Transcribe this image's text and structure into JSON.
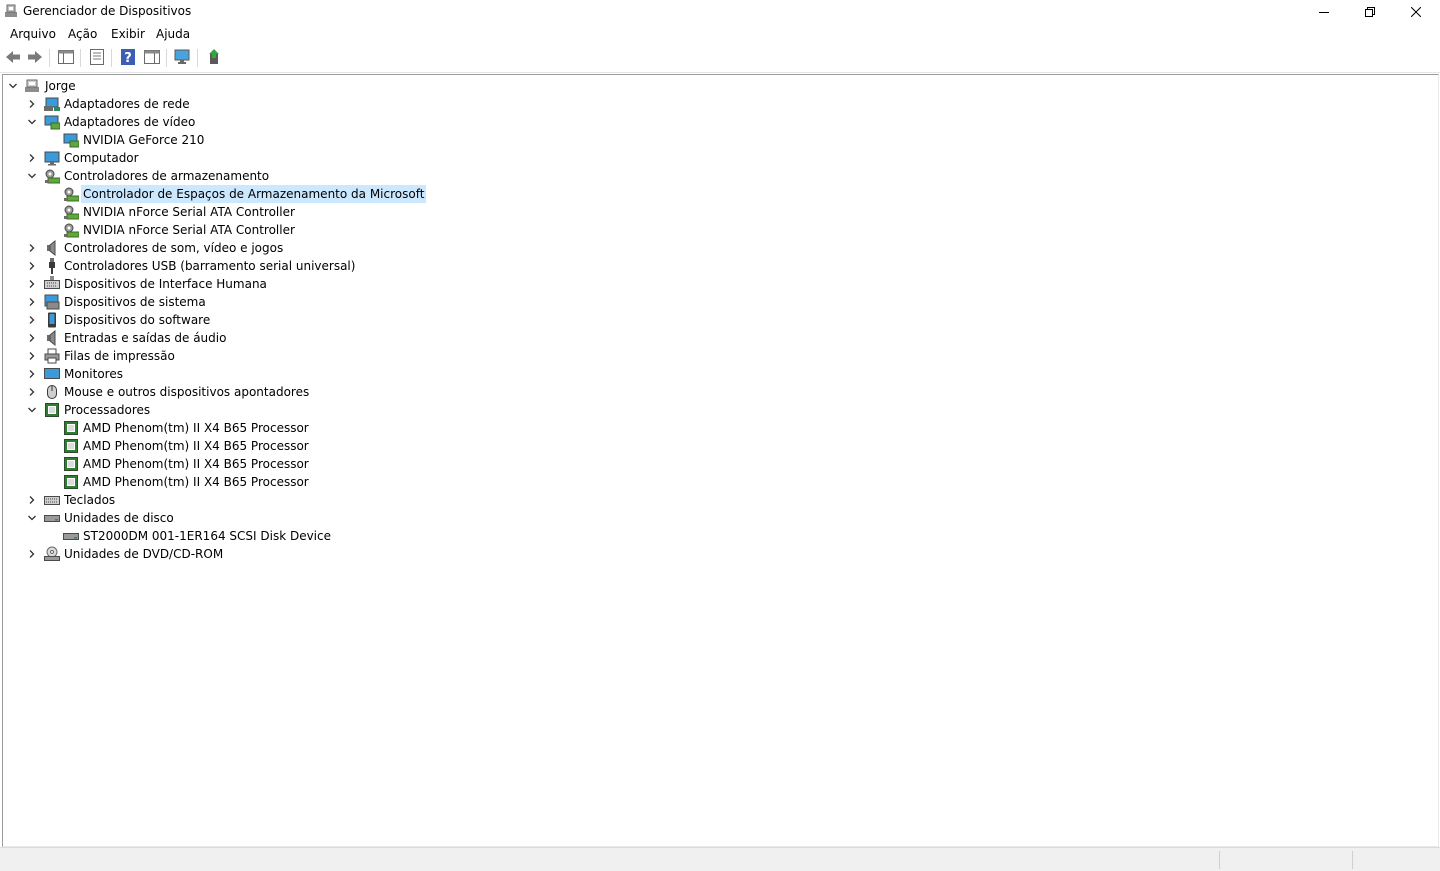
{
  "window": {
    "title": "Gerenciador de Dispositivos",
    "controls": {
      "minimize": "minimize-icon",
      "restore": "restore-icon",
      "close": "close-icon"
    }
  },
  "menu": {
    "items": [
      {
        "label": "Arquivo"
      },
      {
        "label": "Ação"
      },
      {
        "label": "Exibir"
      },
      {
        "label": "Ajuda"
      }
    ]
  },
  "toolbar": {
    "buttons": [
      {
        "icon": "back-arrow-icon"
      },
      {
        "icon": "forward-arrow-icon"
      },
      {
        "icon": "show-hide-console-tree-icon"
      },
      {
        "icon": "properties-icon"
      },
      {
        "icon": "help-icon"
      },
      {
        "icon": "action-pane-icon"
      },
      {
        "icon": "scan-hardware-icon"
      },
      {
        "icon": "add-legacy-hardware-icon"
      }
    ]
  },
  "tree": {
    "root": {
      "label": "Jorge",
      "expanded": true,
      "icon": "computer-root-icon"
    },
    "items": [
      {
        "label": "Adaptadores de rede",
        "level": 1,
        "expander": "collapsed",
        "icon": "network-adapter-icon"
      },
      {
        "label": "Adaptadores de vídeo",
        "level": 1,
        "expander": "expanded",
        "icon": "display-adapter-icon"
      },
      {
        "label": "NVIDIA GeForce 210",
        "level": 2,
        "expander": "none",
        "icon": "display-adapter-icon"
      },
      {
        "label": "Computador",
        "level": 1,
        "expander": "collapsed",
        "icon": "computer-icon"
      },
      {
        "label": "Controladores de armazenamento",
        "level": 1,
        "expander": "expanded",
        "icon": "storage-controller-icon"
      },
      {
        "label": "Controlador de Espaços de Armazenamento da Microsoft",
        "level": 2,
        "expander": "none",
        "icon": "storage-controller-icon",
        "selected": true
      },
      {
        "label": "NVIDIA nForce Serial ATA Controller",
        "level": 2,
        "expander": "none",
        "icon": "storage-controller-icon"
      },
      {
        "label": "NVIDIA nForce Serial ATA Controller",
        "level": 2,
        "expander": "none",
        "icon": "storage-controller-icon"
      },
      {
        "label": "Controladores de som, vídeo e jogos",
        "level": 1,
        "expander": "collapsed",
        "icon": "speaker-icon"
      },
      {
        "label": "Controladores USB (barramento serial universal)",
        "level": 1,
        "expander": "collapsed",
        "icon": "usb-icon"
      },
      {
        "label": "Dispositivos de Interface Humana",
        "level": 1,
        "expander": "collapsed",
        "icon": "hid-icon"
      },
      {
        "label": "Dispositivos de sistema",
        "level": 1,
        "expander": "collapsed",
        "icon": "system-device-icon"
      },
      {
        "label": "Dispositivos do software",
        "level": 1,
        "expander": "collapsed",
        "icon": "software-device-icon"
      },
      {
        "label": "Entradas e saídas de áudio",
        "level": 1,
        "expander": "collapsed",
        "icon": "speaker-icon"
      },
      {
        "label": "Filas de impressão",
        "level": 1,
        "expander": "collapsed",
        "icon": "printer-icon"
      },
      {
        "label": "Monitores",
        "level": 1,
        "expander": "collapsed",
        "icon": "monitor-icon"
      },
      {
        "label": "Mouse e outros dispositivos apontadores",
        "level": 1,
        "expander": "collapsed",
        "icon": "mouse-icon"
      },
      {
        "label": "Processadores",
        "level": 1,
        "expander": "expanded",
        "icon": "processor-icon"
      },
      {
        "label": "AMD Phenom(tm) II X4 B65 Processor",
        "level": 2,
        "expander": "none",
        "icon": "processor-icon"
      },
      {
        "label": "AMD Phenom(tm) II X4 B65 Processor",
        "level": 2,
        "expander": "none",
        "icon": "processor-icon"
      },
      {
        "label": "AMD Phenom(tm) II X4 B65 Processor",
        "level": 2,
        "expander": "none",
        "icon": "processor-icon"
      },
      {
        "label": "AMD Phenom(tm) II X4 B65 Processor",
        "level": 2,
        "expander": "none",
        "icon": "processor-icon"
      },
      {
        "label": "Teclados",
        "level": 1,
        "expander": "collapsed",
        "icon": "keyboard-icon"
      },
      {
        "label": "Unidades de disco",
        "level": 1,
        "expander": "expanded",
        "icon": "disk-drive-icon"
      },
      {
        "label": "ST2000DM 001-1ER164 SCSI Disk Device",
        "level": 2,
        "expander": "none",
        "icon": "disk-drive-icon"
      },
      {
        "label": "Unidades de DVD/CD-ROM",
        "level": 1,
        "expander": "collapsed",
        "icon": "dvd-drive-icon"
      }
    ]
  },
  "colors": {
    "selection": "#cce8ff",
    "accent": "#0078d7"
  }
}
